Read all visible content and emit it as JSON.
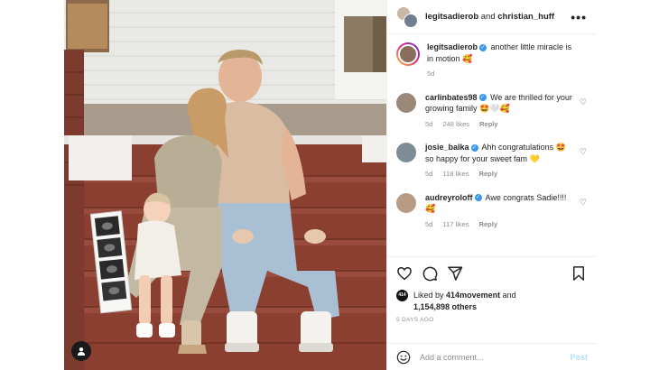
{
  "header": {
    "user1": "legitsadierob",
    "joiner": "and",
    "user2": "christian_huff",
    "more_icon": "•••"
  },
  "caption": {
    "username": "legitsadierob",
    "text": "another little miracle is in motion",
    "emoji": "🥰",
    "time": "5d"
  },
  "comments": [
    {
      "username": "carlinbates98",
      "text": "We are thrilled for your growing family",
      "emoji": "🤩🤍🥰",
      "time": "5d",
      "likes": "248 likes",
      "reply": "Reply",
      "avatar_color": "#9a8878"
    },
    {
      "username": "josie_balka",
      "text": "Ahh congratulations",
      "text2": "so happy for your sweet fam",
      "emoji1": "🤩",
      "emoji2": "💛",
      "time": "5d",
      "likes": "118 likes",
      "reply": "Reply",
      "avatar_color": "#7d8c95"
    },
    {
      "username": "audreyroloff",
      "text": "Awe congrats Sadie!!!!",
      "emoji": "🥰",
      "time": "5d",
      "likes": "117 likes",
      "reply": "Reply",
      "avatar_color": "#b79b84"
    }
  ],
  "likes": {
    "prefix": "Liked by",
    "user": "414movement",
    "joiner": "and",
    "count": "1,154,898 others",
    "avatar_text": "414"
  },
  "time_ago": "5 DAYS AGO",
  "add_comment": {
    "placeholder": "Add a comment...",
    "post_label": "Post"
  },
  "colors": {
    "verified": "#3897f0",
    "post_disabled": "#b2dffc",
    "meta_gray": "#8e8e8e"
  }
}
